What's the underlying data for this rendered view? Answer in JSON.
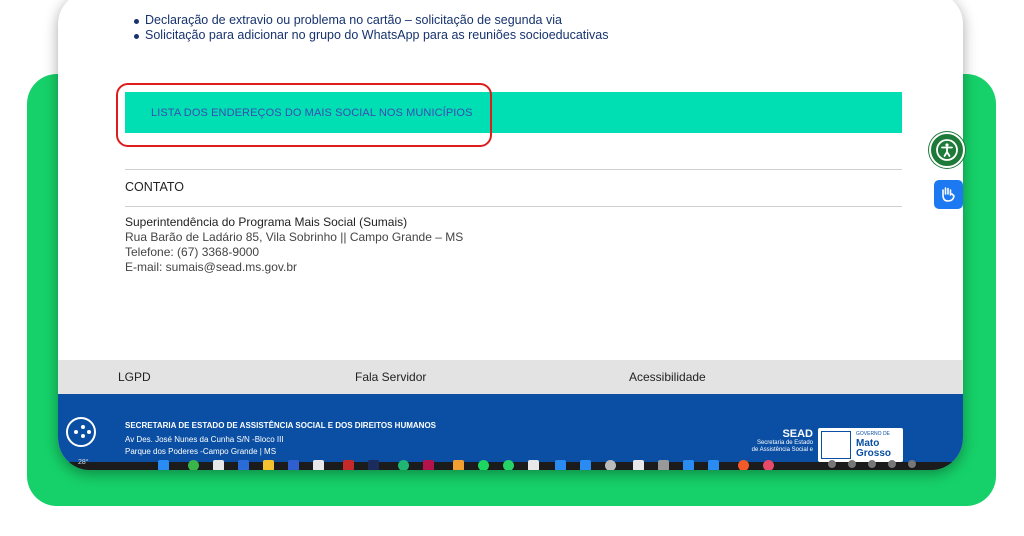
{
  "links": [
    "Declaração de extravio ou problema no cartão – solicitação de segunda via",
    "Solicitação para adicionar no grupo do WhatsApp para as reuniões socioeducativas"
  ],
  "highlight_link": "LISTA DOS ENDEREÇOS DO MAIS SOCIAL NOS MUNICÍPIOS",
  "contact": {
    "heading": "CONTATO",
    "org": "Superintendência do Programa Mais Social (Sumais)",
    "address": "Rua Barão de Ladário 85, Vila Sobrinho ||  Campo Grande – MS",
    "phone": "Telefone: (67) 3368-9000",
    "email": "E-mail: sumais@sead.ms.gov.br"
  },
  "footer_nav": [
    "LGPD",
    "Fala Servidor",
    "Acessibilidade"
  ],
  "footer": {
    "org_name": "SECRETARIA DE ESTADO DE ASSISTÊNCIA SOCIAL E DOS DIREITOS HUMANOS",
    "address1": "Av Des. José Nunes da Cunha S/N -Bloco III",
    "address2": "Parque dos Poderes -Campo Grande | MS",
    "logo_sead": "SEAD",
    "logo_sub1": "Secretaria de Estado",
    "logo_sub2": "de Assistência Social e",
    "logo_gov": "GOVERNO DE",
    "logo_state1": "Mato",
    "logo_state2": "Grosso"
  },
  "taskbar": {
    "temperature": "28°"
  },
  "colors": {
    "accent_mint": "#00dfb3",
    "footer_blue": "#0a4fa3",
    "highlight_red": "#e01b1b",
    "frame_green": "#16d169"
  }
}
